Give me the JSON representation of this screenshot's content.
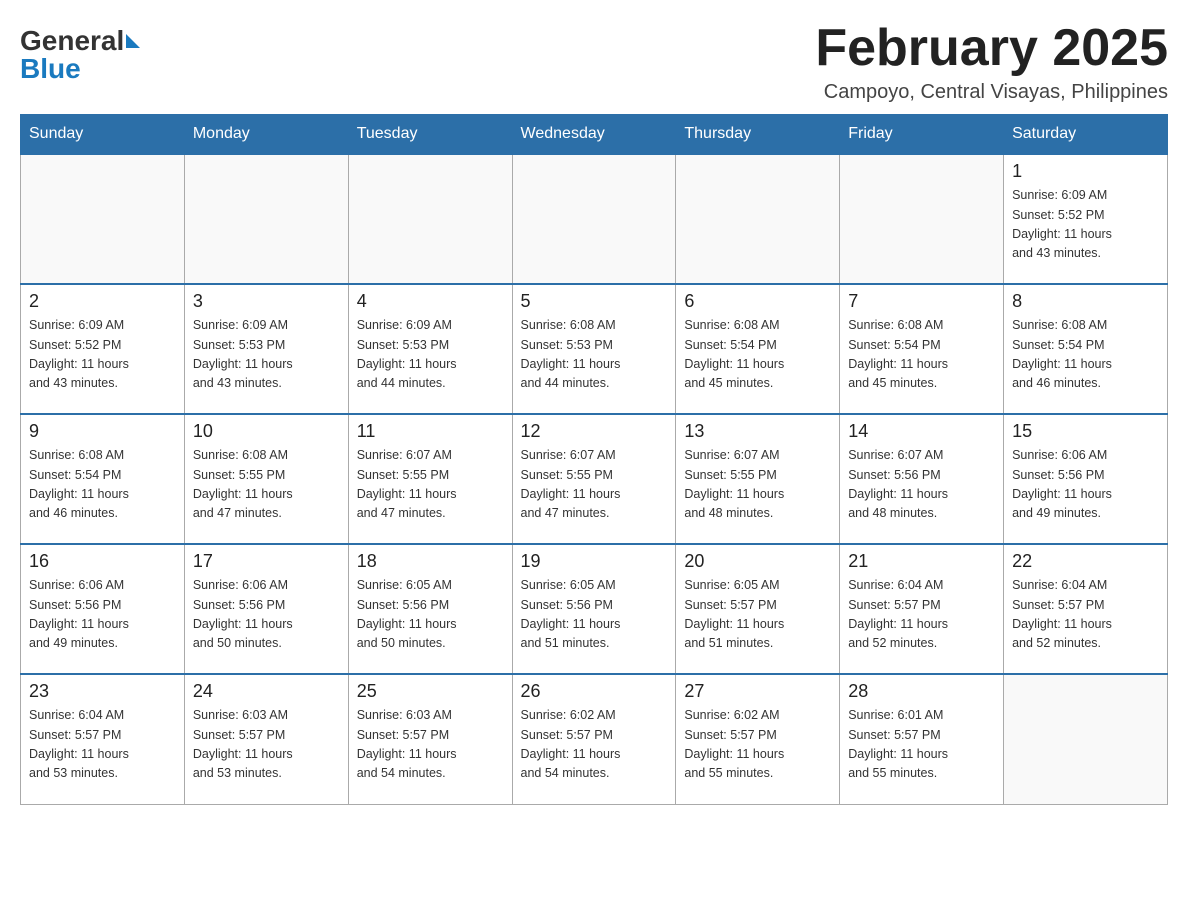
{
  "header": {
    "logo_general": "General",
    "logo_blue": "Blue",
    "month_title": "February 2025",
    "location": "Campoyo, Central Visayas, Philippines"
  },
  "weekdays": [
    "Sunday",
    "Monday",
    "Tuesday",
    "Wednesday",
    "Thursday",
    "Friday",
    "Saturday"
  ],
  "weeks": [
    [
      {
        "day": "",
        "info": ""
      },
      {
        "day": "",
        "info": ""
      },
      {
        "day": "",
        "info": ""
      },
      {
        "day": "",
        "info": ""
      },
      {
        "day": "",
        "info": ""
      },
      {
        "day": "",
        "info": ""
      },
      {
        "day": "1",
        "info": "Sunrise: 6:09 AM\nSunset: 5:52 PM\nDaylight: 11 hours\nand 43 minutes."
      }
    ],
    [
      {
        "day": "2",
        "info": "Sunrise: 6:09 AM\nSunset: 5:52 PM\nDaylight: 11 hours\nand 43 minutes."
      },
      {
        "day": "3",
        "info": "Sunrise: 6:09 AM\nSunset: 5:53 PM\nDaylight: 11 hours\nand 43 minutes."
      },
      {
        "day": "4",
        "info": "Sunrise: 6:09 AM\nSunset: 5:53 PM\nDaylight: 11 hours\nand 44 minutes."
      },
      {
        "day": "5",
        "info": "Sunrise: 6:08 AM\nSunset: 5:53 PM\nDaylight: 11 hours\nand 44 minutes."
      },
      {
        "day": "6",
        "info": "Sunrise: 6:08 AM\nSunset: 5:54 PM\nDaylight: 11 hours\nand 45 minutes."
      },
      {
        "day": "7",
        "info": "Sunrise: 6:08 AM\nSunset: 5:54 PM\nDaylight: 11 hours\nand 45 minutes."
      },
      {
        "day": "8",
        "info": "Sunrise: 6:08 AM\nSunset: 5:54 PM\nDaylight: 11 hours\nand 46 minutes."
      }
    ],
    [
      {
        "day": "9",
        "info": "Sunrise: 6:08 AM\nSunset: 5:54 PM\nDaylight: 11 hours\nand 46 minutes."
      },
      {
        "day": "10",
        "info": "Sunrise: 6:08 AM\nSunset: 5:55 PM\nDaylight: 11 hours\nand 47 minutes."
      },
      {
        "day": "11",
        "info": "Sunrise: 6:07 AM\nSunset: 5:55 PM\nDaylight: 11 hours\nand 47 minutes."
      },
      {
        "day": "12",
        "info": "Sunrise: 6:07 AM\nSunset: 5:55 PM\nDaylight: 11 hours\nand 47 minutes."
      },
      {
        "day": "13",
        "info": "Sunrise: 6:07 AM\nSunset: 5:55 PM\nDaylight: 11 hours\nand 48 minutes."
      },
      {
        "day": "14",
        "info": "Sunrise: 6:07 AM\nSunset: 5:56 PM\nDaylight: 11 hours\nand 48 minutes."
      },
      {
        "day": "15",
        "info": "Sunrise: 6:06 AM\nSunset: 5:56 PM\nDaylight: 11 hours\nand 49 minutes."
      }
    ],
    [
      {
        "day": "16",
        "info": "Sunrise: 6:06 AM\nSunset: 5:56 PM\nDaylight: 11 hours\nand 49 minutes."
      },
      {
        "day": "17",
        "info": "Sunrise: 6:06 AM\nSunset: 5:56 PM\nDaylight: 11 hours\nand 50 minutes."
      },
      {
        "day": "18",
        "info": "Sunrise: 6:05 AM\nSunset: 5:56 PM\nDaylight: 11 hours\nand 50 minutes."
      },
      {
        "day": "19",
        "info": "Sunrise: 6:05 AM\nSunset: 5:56 PM\nDaylight: 11 hours\nand 51 minutes."
      },
      {
        "day": "20",
        "info": "Sunrise: 6:05 AM\nSunset: 5:57 PM\nDaylight: 11 hours\nand 51 minutes."
      },
      {
        "day": "21",
        "info": "Sunrise: 6:04 AM\nSunset: 5:57 PM\nDaylight: 11 hours\nand 52 minutes."
      },
      {
        "day": "22",
        "info": "Sunrise: 6:04 AM\nSunset: 5:57 PM\nDaylight: 11 hours\nand 52 minutes."
      }
    ],
    [
      {
        "day": "23",
        "info": "Sunrise: 6:04 AM\nSunset: 5:57 PM\nDaylight: 11 hours\nand 53 minutes."
      },
      {
        "day": "24",
        "info": "Sunrise: 6:03 AM\nSunset: 5:57 PM\nDaylight: 11 hours\nand 53 minutes."
      },
      {
        "day": "25",
        "info": "Sunrise: 6:03 AM\nSunset: 5:57 PM\nDaylight: 11 hours\nand 54 minutes."
      },
      {
        "day": "26",
        "info": "Sunrise: 6:02 AM\nSunset: 5:57 PM\nDaylight: 11 hours\nand 54 minutes."
      },
      {
        "day": "27",
        "info": "Sunrise: 6:02 AM\nSunset: 5:57 PM\nDaylight: 11 hours\nand 55 minutes."
      },
      {
        "day": "28",
        "info": "Sunrise: 6:01 AM\nSunset: 5:57 PM\nDaylight: 11 hours\nand 55 minutes."
      },
      {
        "day": "",
        "info": ""
      }
    ]
  ]
}
